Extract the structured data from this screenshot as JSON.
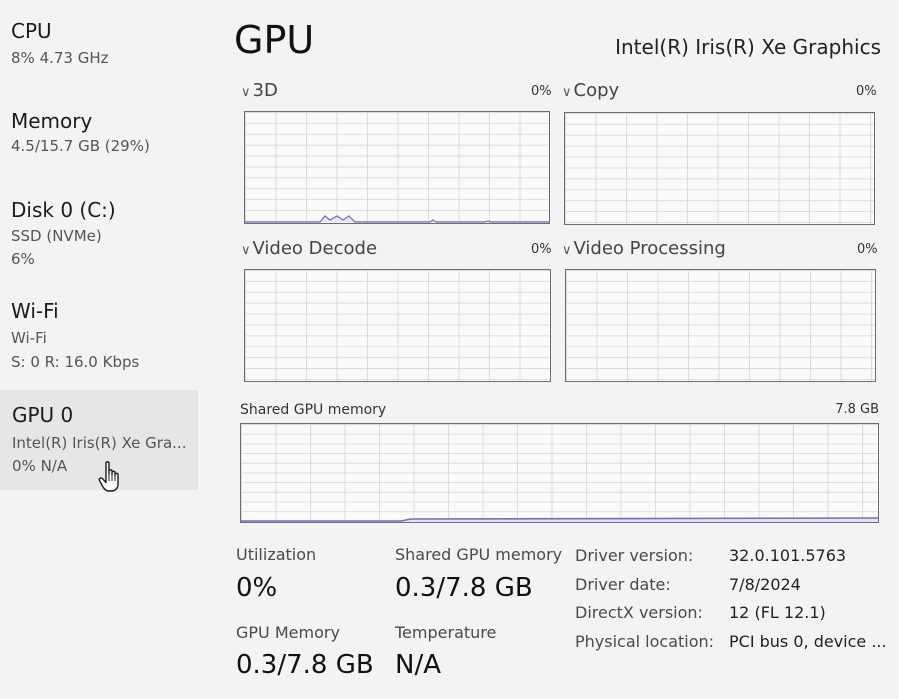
{
  "sidebar": {
    "items": [
      {
        "title": "CPU",
        "lines": [
          "8% 4.73 GHz"
        ]
      },
      {
        "title": "Memory",
        "lines": [
          "4.5/15.7 GB (29%)"
        ]
      },
      {
        "title": "Disk 0 (C:)",
        "lines": [
          "SSD (NVMe)",
          "6%"
        ]
      },
      {
        "title": "Wi-Fi",
        "lines": [
          "Wi-Fi",
          "S: 0 R: 16.0 Kbps"
        ]
      },
      {
        "title": "GPU 0",
        "lines": [
          "Intel(R) Iris(R) Xe Gra...",
          "0% N/A"
        ]
      }
    ]
  },
  "header": {
    "title": "GPU",
    "adapter": "Intel(R) Iris(R) Xe Graphics"
  },
  "engines": [
    {
      "name": "3D",
      "percent": "0%"
    },
    {
      "name": "Copy",
      "percent": "0%"
    },
    {
      "name": "Video Decode",
      "percent": "0%"
    },
    {
      "name": "Video Processing",
      "percent": "0%"
    }
  ],
  "shared_memory": {
    "label": "Shared GPU memory",
    "total": "7.8 GB"
  },
  "stats": {
    "utilization_label": "Utilization",
    "utilization_value": "0%",
    "shared_label": "Shared GPU memory",
    "shared_value": "0.3/7.8 GB",
    "gpu_memory_label": "GPU Memory",
    "gpu_memory_value": "0.3/7.8 GB",
    "temperature_label": "Temperature",
    "temperature_value": "N/A"
  },
  "info": {
    "driver_version_label": "Driver version:",
    "driver_version": "32.0.101.5763",
    "driver_date_label": "Driver date:",
    "driver_date": "7/8/2024",
    "directx_label": "DirectX version:",
    "directx": "12 (FL 12.1)",
    "location_label": "Physical location:",
    "location": "PCI bus 0, device ..."
  },
  "icons": {
    "chevron": "chevron-down-icon",
    "cursor": "hand-pointer-icon"
  },
  "colors": {
    "graph_line": "#7a68c8",
    "selected_bg": "#e6e6e8"
  }
}
